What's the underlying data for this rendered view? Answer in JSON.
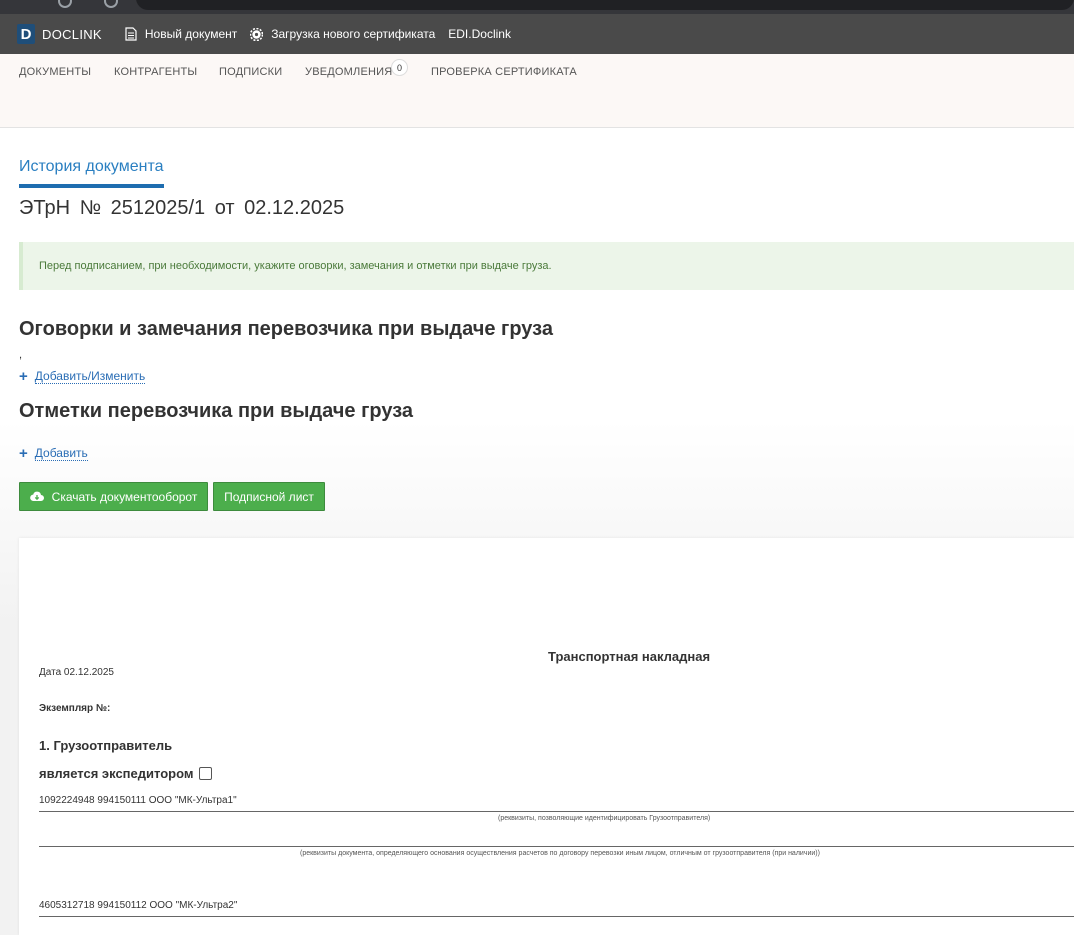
{
  "topbar": {
    "brand_letter": "D",
    "brand_name": "DOCLINK",
    "new_document": "Новый документ",
    "upload_certificate": "Загрузка нового сертификата",
    "edi_link": "EDI.Doclink"
  },
  "menu": {
    "items": [
      "ДОКУМЕНТЫ",
      "КОНТРАГЕНТЫ",
      "ПОДПИСКИ",
      "УВЕДОМЛЕНИЯ",
      "ПРОВЕРКА СЕРТИФИКАТА"
    ],
    "notifications_count": "0"
  },
  "history_tab": "История документа",
  "document": {
    "title": "ЭТрН №   2512025/1  от   02.12.2025"
  },
  "alert_text": "Перед подписанием, при необходимости, укажите оговорки, замечания и отметки при выдаче груза.",
  "remarks": {
    "title": "Оговорки и замечания перевозчика при выдаче груза",
    "value": ",",
    "add_label": "Добавить/Изменить"
  },
  "marks": {
    "title": "Отметки перевозчика при выдаче груза",
    "add_label": "Добавить"
  },
  "buttons": {
    "download": "Скачать документооборот",
    "signature_sheet": "Подписной лист"
  },
  "waybill": {
    "heading": "Транспортная накладная",
    "date_line": "Дата  02.12.2025",
    "exemplar_label": "Экземпляр №:",
    "shipper_title": "1. Грузоотправитель",
    "is_forwarder_label": "является экспедитором",
    "shipper_details": "1092224948 994150111 ООО \"МК-Ультра1\"",
    "shipper_hint": "(реквизиты, позволяющие идентифицировать Грузоотправителя)",
    "payment_doc_hint": "(реквизиты документа, определяющего основания осуществления расчетов по договору перевозки иным лицом, отличным от грузоотправителя (при наличии))",
    "consignee_details": "4605312718 994150112 ООО \"МК-Ультра2\""
  },
  "colors": {
    "accent": "#2a7fc1",
    "button_green": "#4cae4c",
    "alert_bg": "#ecf5e9",
    "topbar_bg": "#4a4a4a"
  }
}
